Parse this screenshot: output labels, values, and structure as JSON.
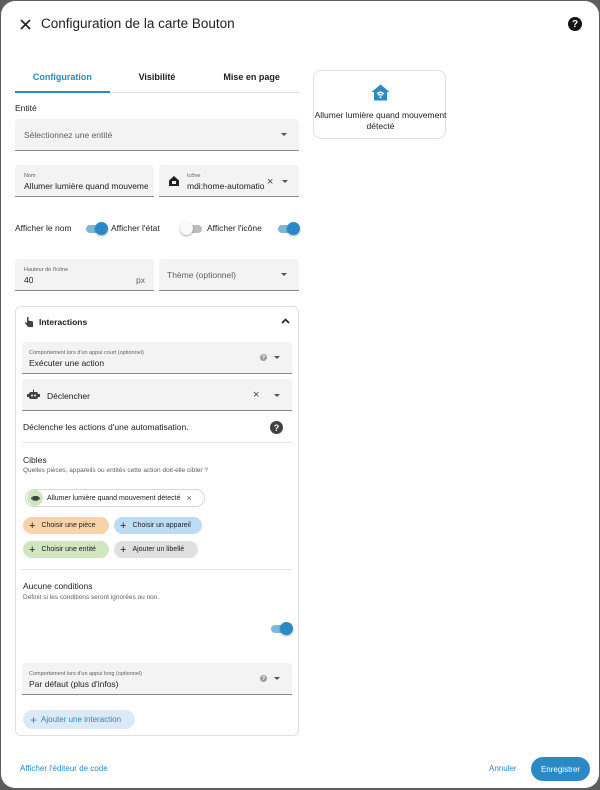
{
  "dialog": {
    "title": "Configuration de la carte Bouton"
  },
  "tabs": [
    {
      "label": "Configuration",
      "active": true
    },
    {
      "label": "Visibilité",
      "active": false
    },
    {
      "label": "Mise en page",
      "active": false
    }
  ],
  "entity": {
    "section_label": "Entité",
    "placeholder": "Sélectionnez une entité"
  },
  "name_field": {
    "label": "Nom",
    "value": "Allumer lumière quand mouvement détecté"
  },
  "icon_field": {
    "label": "Icône",
    "value": "mdi:home-automation"
  },
  "toggles": {
    "show_name": {
      "label": "Afficher le nom",
      "on": true
    },
    "show_state": {
      "label": "Afficher l'état",
      "on": false
    },
    "show_icon": {
      "label": "Afficher l'icône",
      "on": true
    }
  },
  "icon_height": {
    "label": "Hauteur de l'icône",
    "value": "40",
    "unit": "px"
  },
  "theme": {
    "placeholder": "Thème (optionnel)"
  },
  "interactions": {
    "title": "Interactions",
    "tap_action": {
      "label": "Comportement lors d'un appui court (optionnel)",
      "value": "Exécuter une action"
    },
    "trigger": {
      "value": "Déclencher"
    },
    "trigger_description": "Déclenche les actions d'une automatisation.",
    "targets": {
      "title": "Cibles",
      "subtitle": "Quelles pièces, appareils ou entités cette action doit-elle cibler ?",
      "selected": "Allumer lumière quand mouvement détecté",
      "choose_room": "Choisir une pièce",
      "choose_device": "Choisir un appareil",
      "choose_entity": "Choisir une entité",
      "add_label": "Ajouter un libellé"
    },
    "conditions": {
      "title": "Aucune conditions",
      "subtitle": "Définit si les conditions seront ignorées ou non.",
      "on": true
    },
    "hold_action": {
      "label": "Comportement lors d'un appui long (optionnel)",
      "value": "Par défaut (plus d'infos)"
    },
    "add_interaction": "Ajouter une interaction"
  },
  "preview": {
    "name": "Allumer lumière quand mouvement détecté"
  },
  "footer": {
    "code_editor": "Afficher l'éditeur de code",
    "cancel": "Annuler",
    "save": "Enregistrer"
  },
  "colors": {
    "accent": "#2b8ac6",
    "room_chip": "#f8d2a8",
    "device_chip": "#bcdcf3",
    "entity_chip": "#cfe6c0",
    "label_chip": "#e0e0e0"
  }
}
